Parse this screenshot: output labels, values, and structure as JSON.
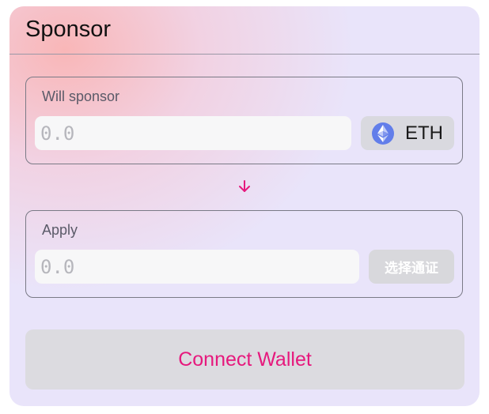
{
  "header": {
    "title": "Sponsor"
  },
  "sponsor_box": {
    "label": "Will sponsor",
    "amount_placeholder": "0.0",
    "token": {
      "symbol": "ETH",
      "icon": "ethereum-icon"
    }
  },
  "direction_icon": "arrow-down-icon",
  "apply_box": {
    "label": "Apply",
    "amount_placeholder": "0.0",
    "select_token_label": "选择通证"
  },
  "connect_button": {
    "label": "Connect Wallet"
  },
  "colors": {
    "accent": "#e6197d",
    "eth": "#627eea",
    "card_bg": "#e9e4fa"
  }
}
